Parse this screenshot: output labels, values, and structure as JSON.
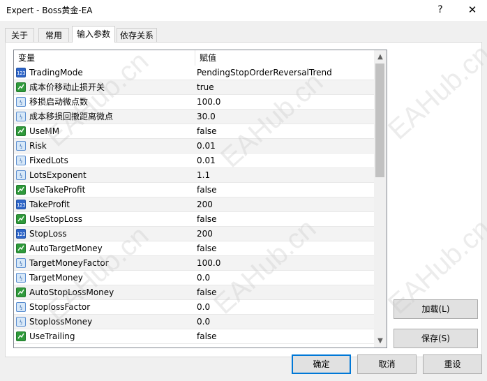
{
  "window": {
    "title": "Expert - Boss黄金-EA",
    "help_label": "?",
    "close_label": "✕"
  },
  "tabs": [
    {
      "label": "关于",
      "active": false
    },
    {
      "label": "常用",
      "active": false
    },
    {
      "label": "输入参数",
      "active": true
    },
    {
      "label": "依存关系",
      "active": false
    }
  ],
  "grid": {
    "columns": {
      "variable": "变量",
      "value": "赋值"
    },
    "rows": [
      {
        "type": "int",
        "icon": "int-icon",
        "name": "TradingMode",
        "value": "PendingStopOrderReversalTrend"
      },
      {
        "type": "bool",
        "icon": "bool-icon",
        "name": "成本价移动止损开关",
        "value": "true"
      },
      {
        "type": "double",
        "icon": "double-icon",
        "name": "移损启动微点数",
        "value": "100.0"
      },
      {
        "type": "double",
        "icon": "double-icon",
        "name": "成本移损回撤距离微点",
        "value": "30.0"
      },
      {
        "type": "bool",
        "icon": "bool-icon",
        "name": "UseMM",
        "value": "false"
      },
      {
        "type": "double",
        "icon": "double-icon",
        "name": "Risk",
        "value": "0.01"
      },
      {
        "type": "double",
        "icon": "double-icon",
        "name": "FixedLots",
        "value": "0.01"
      },
      {
        "type": "double",
        "icon": "double-icon",
        "name": "LotsExponent",
        "value": "1.1"
      },
      {
        "type": "bool",
        "icon": "bool-icon",
        "name": "UseTakeProfit",
        "value": "false"
      },
      {
        "type": "int",
        "icon": "int-icon",
        "name": "TakeProfit",
        "value": "200"
      },
      {
        "type": "bool",
        "icon": "bool-icon",
        "name": "UseStopLoss",
        "value": "false"
      },
      {
        "type": "int",
        "icon": "int-icon",
        "name": "StopLoss",
        "value": "200"
      },
      {
        "type": "bool",
        "icon": "bool-icon",
        "name": "AutoTargetMoney",
        "value": "false"
      },
      {
        "type": "double",
        "icon": "double-icon",
        "name": "TargetMoneyFactor",
        "value": "100.0"
      },
      {
        "type": "double",
        "icon": "double-icon",
        "name": "TargetMoney",
        "value": "0.0"
      },
      {
        "type": "bool",
        "icon": "bool-icon",
        "name": "AutoStopLossMoney",
        "value": "false"
      },
      {
        "type": "double",
        "icon": "double-icon",
        "name": "StoplossFactor",
        "value": "0.0"
      },
      {
        "type": "double",
        "icon": "double-icon",
        "name": "StoplossMoney",
        "value": "0.0"
      },
      {
        "type": "bool",
        "icon": "bool-icon",
        "name": "UseTrailing",
        "value": "false"
      }
    ]
  },
  "buttons": {
    "load": "加载(L)",
    "save": "保存(S)",
    "ok": "确定",
    "cancel": "取消",
    "reset": "重设"
  },
  "watermark": "EAHub.cn",
  "colors": {
    "accent": "#0078d7",
    "int_icon": "#2f66c8",
    "bool_icon": "#2f9a3b",
    "double_icon": "#5a8ed0"
  }
}
